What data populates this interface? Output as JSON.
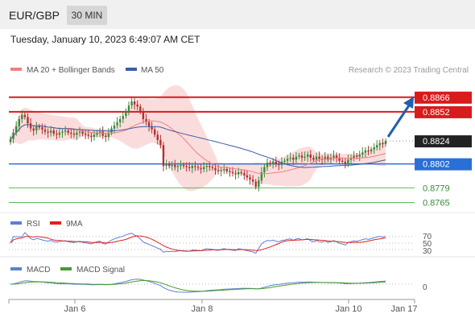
{
  "header": {
    "pair": "EUR/GBP",
    "timeframe": "30 MIN"
  },
  "timestamp": "Tuesday, January 10, 2023 6:49:07 AM CET",
  "legend": {
    "ma20": "MA 20 + Bollinger Bands",
    "ma50": "MA 50",
    "copyright": "Research © 2023 Trading Central"
  },
  "levels": [
    {
      "value": "0.8866",
      "kind": "resistance"
    },
    {
      "value": "0.8852",
      "kind": "resistance"
    },
    {
      "value": "0.8824",
      "kind": "current"
    },
    {
      "value": "0.8802",
      "kind": "pivot"
    },
    {
      "value": "0.8779",
      "kind": "support"
    },
    {
      "value": "0.8765",
      "kind": "support"
    }
  ],
  "rsi": {
    "title": "RSI",
    "signal": "9MA",
    "levels": [
      "70",
      "50",
      "30"
    ]
  },
  "macd": {
    "title": "MACD",
    "signal": "MACD Signal",
    "zero": "0"
  },
  "xaxis": [
    "Jan 6",
    "Jan 8",
    "Jan 10",
    "Jan 17"
  ],
  "colors": {
    "resistance": "#d81b1b",
    "pivot": "#2a6fd6",
    "support": "#5fb85f",
    "current": "#222222",
    "bollinger": "#fbdcdc",
    "ma20": "#f08080",
    "ma50": "#3b5ea8",
    "rsi": "#5b7fd6",
    "rsi9ma": "#e02020",
    "macd": "#5b7fd6",
    "macdSignal": "#4a9a2a",
    "arrow": "#1f5fb0"
  },
  "chart_data": {
    "type": "candlestick",
    "instrument": "EUR/GBP",
    "timeframe": "30 MIN",
    "price_range": [
      0.876,
      0.8872
    ],
    "x_labels": [
      "Jan 6",
      "Jan 8",
      "Jan 10",
      "Jan 17"
    ],
    "horizontal_levels": [
      0.8866,
      0.8852,
      0.8824,
      0.8802,
      0.8779,
      0.8765
    ],
    "closes": [
      0.8826,
      0.8832,
      0.8838,
      0.8845,
      0.8849,
      0.8847,
      0.8841,
      0.8836,
      0.8834,
      0.8838,
      0.8837,
      0.8835,
      0.8833,
      0.8832,
      0.8834,
      0.8831,
      0.883,
      0.8832,
      0.8833,
      0.8834,
      0.8832,
      0.8831,
      0.883,
      0.8832,
      0.8833,
      0.8831,
      0.883,
      0.8829,
      0.8828,
      0.883,
      0.8832,
      0.8833,
      0.8829,
      0.8828,
      0.8832,
      0.8836,
      0.8839,
      0.8842,
      0.8845,
      0.8848,
      0.8853,
      0.8858,
      0.8862,
      0.8859,
      0.8857,
      0.8852,
      0.8845,
      0.8842,
      0.8838,
      0.8835,
      0.883,
      0.8825,
      0.882,
      0.88,
      0.8802,
      0.88,
      0.8801,
      0.8799,
      0.88,
      0.8801,
      0.88,
      0.8799,
      0.8798,
      0.88,
      0.8799,
      0.8798,
      0.8797,
      0.8799,
      0.88,
      0.8799,
      0.8798,
      0.8796,
      0.8795,
      0.8796,
      0.8797,
      0.8795,
      0.8794,
      0.8793,
      0.8792,
      0.8794,
      0.8793,
      0.8791,
      0.8789,
      0.8787,
      0.8785,
      0.878,
      0.8786,
      0.8794,
      0.8799,
      0.8803,
      0.8802,
      0.8804,
      0.8802,
      0.8801,
      0.8804,
      0.8805,
      0.8807,
      0.8808,
      0.8806,
      0.8809,
      0.881,
      0.8808,
      0.8809,
      0.8811,
      0.8808,
      0.8806,
      0.8809,
      0.8807,
      0.8806,
      0.8809,
      0.8806,
      0.8808,
      0.881,
      0.8808,
      0.8805,
      0.8804,
      0.8802,
      0.8806,
      0.8808,
      0.881,
      0.8809,
      0.8811,
      0.8813,
      0.8815,
      0.8814,
      0.8816,
      0.8818,
      0.882,
      0.8822,
      0.8821,
      0.8824
    ]
  }
}
